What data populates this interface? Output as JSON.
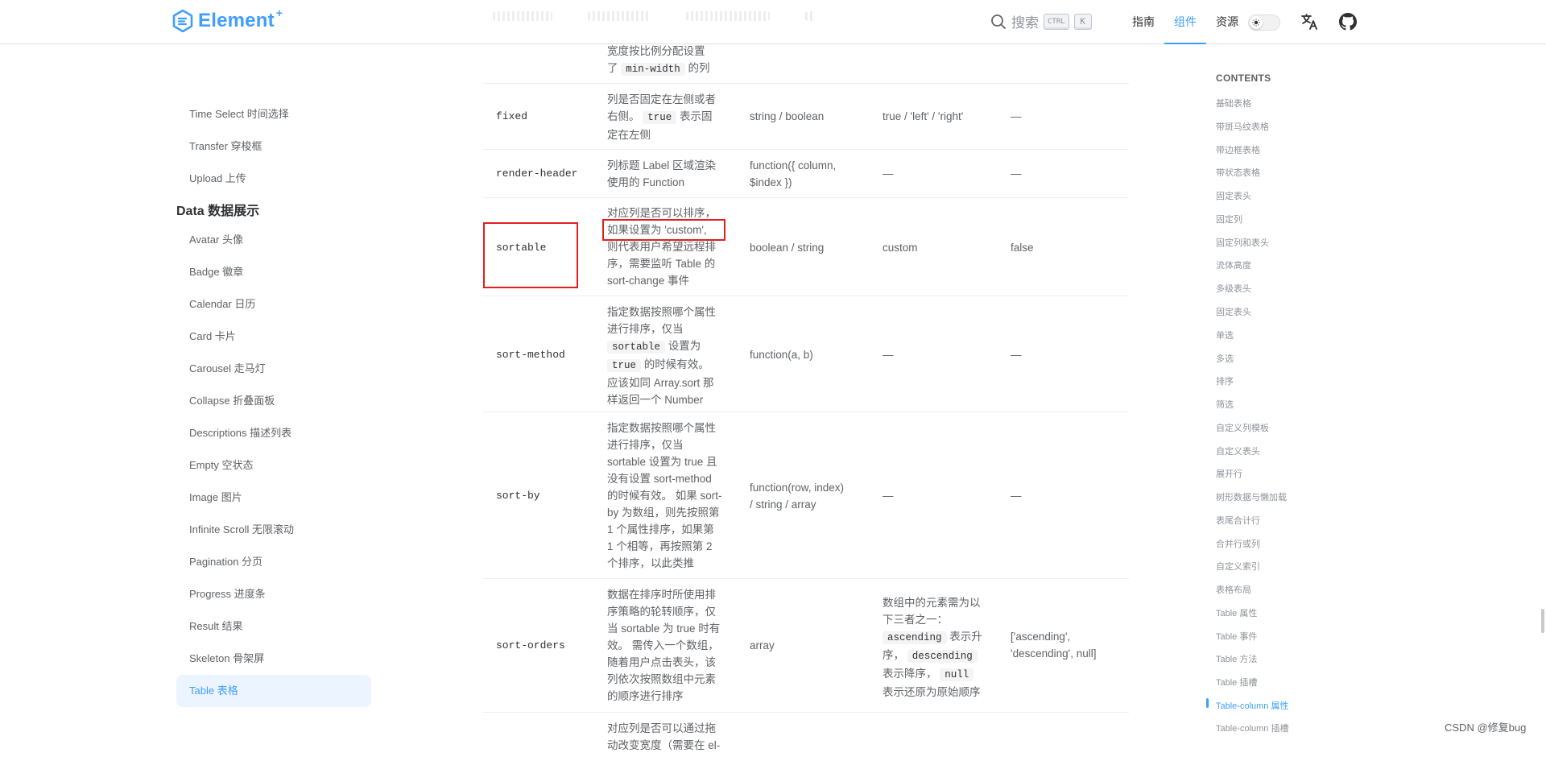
{
  "header": {
    "logo_text": "Element",
    "logo_sup": "+",
    "search_label": "搜索",
    "kbd_ctrl": "CTRL",
    "kbd_k": "K",
    "nav": [
      "指南",
      "组件",
      "资源"
    ]
  },
  "sidebar": {
    "top_items": [
      "Time Select 时间选择",
      "Transfer 穿梭框",
      "Upload 上传"
    ],
    "group_title": "Data 数据展示",
    "group_items": [
      "Avatar 头像",
      "Badge 徽章",
      "Calendar 日历",
      "Card 卡片",
      "Carousel 走马灯",
      "Collapse 折叠面板",
      "Descriptions 描述列表",
      "Empty 空状态",
      "Image 图片",
      "Infinite Scroll 无限滚动",
      "Pagination 分页",
      "Progress 进度条",
      "Result 结果",
      "Skeleton 骨架屏",
      "Table 表格"
    ]
  },
  "table": {
    "r0": {
      "d1": "宽度按比例分配设置",
      "d2a": "了",
      "d2code": "min-width",
      "d2b": "的列"
    },
    "r1": {
      "name": "fixed",
      "d1": "列是否固定在左侧或者",
      "d2a": "右侧。",
      "d2code": "true",
      "d2b": "表示固",
      "d3": "定在左侧",
      "type": "string / boolean",
      "opts": "true / 'left' / 'right'",
      "def": "—"
    },
    "r2": {
      "name": "render-header",
      "d1": "列标题 Label 区域渲染",
      "d2": "使用的 Function",
      "type1": "function({ column,",
      "type2": "$index })",
      "opts": "—",
      "def": "—"
    },
    "r3": {
      "name": "sortable",
      "d1": "对应列是否可以排序，",
      "d2": "如果设置为 'custom',",
      "d3": "则代表用户希望远程排",
      "d4": "序，需要监听 Table 的",
      "d5": "sort-change 事件",
      "type": "boolean / string",
      "opts": "custom",
      "def": "false"
    },
    "r4": {
      "name": "sort-method",
      "d1": "指定数据按照哪个属性",
      "d2": "进行排序，仅当",
      "d3code": "sortable",
      "d3b": "设置为",
      "d4code": "true",
      "d4b": "的时候有效。",
      "d5": "应该如同 Array.sort 那",
      "d6": "样返回一个 Number",
      "type": "function(a, b)",
      "opts": "—",
      "def": "—"
    },
    "r5": {
      "name": "sort-by",
      "d1": "指定数据按照哪个属性",
      "d2": "进行排序，仅当",
      "d3": "sortable 设置为 true 且",
      "d4": "没有设置 sort-method",
      "d5": "的时候有效。 如果 sort-",
      "d6": "by 为数组，则先按照第",
      "d7": "1 个属性排序，如果第",
      "d8": "1 个相等，再按照第 2",
      "d9": "个排序，以此类推",
      "type1": "function(row, index)",
      "type2": "/ string / array",
      "opts": "—",
      "def": "—"
    },
    "r6": {
      "name": "sort-orders",
      "d1": "数据在排序时所使用排",
      "d2": "序策略的轮转顺序，仅",
      "d3": "当 sortable 为 true 时有",
      "d4": "效。 需传入一个数组，",
      "d5": "随着用户点击表头，该",
      "d6": "列依次按照数组中元素",
      "d7": "的顺序进行排序",
      "type": "array",
      "o1": "数组中的元素需为以",
      "o2": "下三者之一：",
      "o3code": "ascending",
      "o3b": "表示升",
      "o4a": "序，",
      "o4code": "descending",
      "o5": "表示降序，",
      "o5code": "null",
      "o6": "表示还原为原始顺序",
      "def1": "['ascending',",
      "def2": "'descending', null]"
    },
    "r7": {
      "d1": "对应列是否可以通过拖",
      "d2": "动改变宽度（需要在 el-"
    }
  },
  "toc": {
    "title": "CONTENTS",
    "items": [
      "基础表格",
      "带斑马纹表格",
      "带边框表格",
      "带状态表格",
      "固定表头",
      "固定列",
      "固定列和表头",
      "流体高度",
      "多级表头",
      "固定表头",
      "单选",
      "多选",
      "排序",
      "筛选",
      "自定义列模板",
      "自定义表头",
      "展开行",
      "树形数据与懒加载",
      "表尾合计行",
      "合并行或列",
      "自定义索引",
      "表格布局",
      "Table 属性",
      "Table 事件",
      "Table 方法",
      "Table 插槽",
      "Table-column 属性",
      "Table-column 插槽"
    ]
  },
  "watermark": "CSDN @修复bug",
  "colors": {
    "brand": "#409eff",
    "highlight": "#e02020"
  }
}
